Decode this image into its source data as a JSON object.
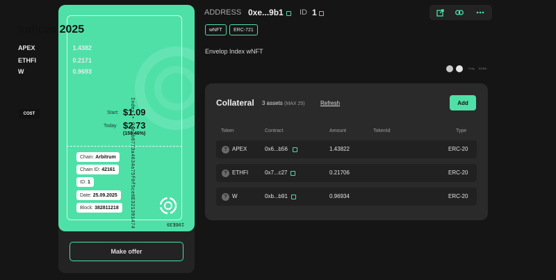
{
  "card": {
    "title": "Indices 2025",
    "assets": [
      {
        "symbol": "APEX",
        "amount": "1.4382"
      },
      {
        "symbol": "ETHFI",
        "amount": "0.2171"
      },
      {
        "symbol": "W",
        "amount": "0.9693"
      }
    ],
    "cost_badge": "COST",
    "start_label": "Start:",
    "start_value": "$1.09",
    "today_label": "Today",
    "today_value": "$2.73",
    "change": "(150.46%)",
    "vertical_address": "Index • 0xe1b0773a4634a75f0f5ce6E321391474",
    "info": [
      {
        "key": "Chain:",
        "value": "Arbitrum"
      },
      {
        "key": "Chain ID:",
        "value": "42161"
      },
      {
        "key": "ID:",
        "value": "1"
      },
      {
        "key": "Date:",
        "value": "25.09.2025"
      },
      {
        "key": "Block:",
        "value": "382811218"
      }
    ],
    "bottom_id": "196E39",
    "accent": "#4fe0a8"
  },
  "make_offer_label": "Make offer",
  "header": {
    "address_label": "ADDRESS",
    "address_value": "0xe...9b1",
    "id_label": "ID",
    "id_value": "1",
    "tags": [
      "wNFT",
      "ERC-721"
    ],
    "actions": [
      "external-link-icon",
      "link-icon",
      "more-icon"
    ]
  },
  "description": "Envelop Index wNFT",
  "owners_text": [
    "Polly",
    "BOBA"
  ],
  "collateral": {
    "title": "Collateral",
    "count": "3 assets",
    "max": "(MAX 25)",
    "refresh_label": "Refresh",
    "add_label": "Add",
    "columns": [
      "Token",
      "Contract",
      "Amount",
      "TokenId",
      "Type"
    ],
    "rows": [
      {
        "token": "APEX",
        "contract": "0x6...b56",
        "amount": "1.43822",
        "token_id": "",
        "type": "ERC-20"
      },
      {
        "token": "ETHFI",
        "contract": "0x7...c27",
        "amount": "0.21706",
        "token_id": "",
        "type": "ERC-20"
      },
      {
        "token": "W",
        "contract": "0xb...b91",
        "amount": "0.96934",
        "token_id": "",
        "type": "ERC-20"
      }
    ]
  }
}
